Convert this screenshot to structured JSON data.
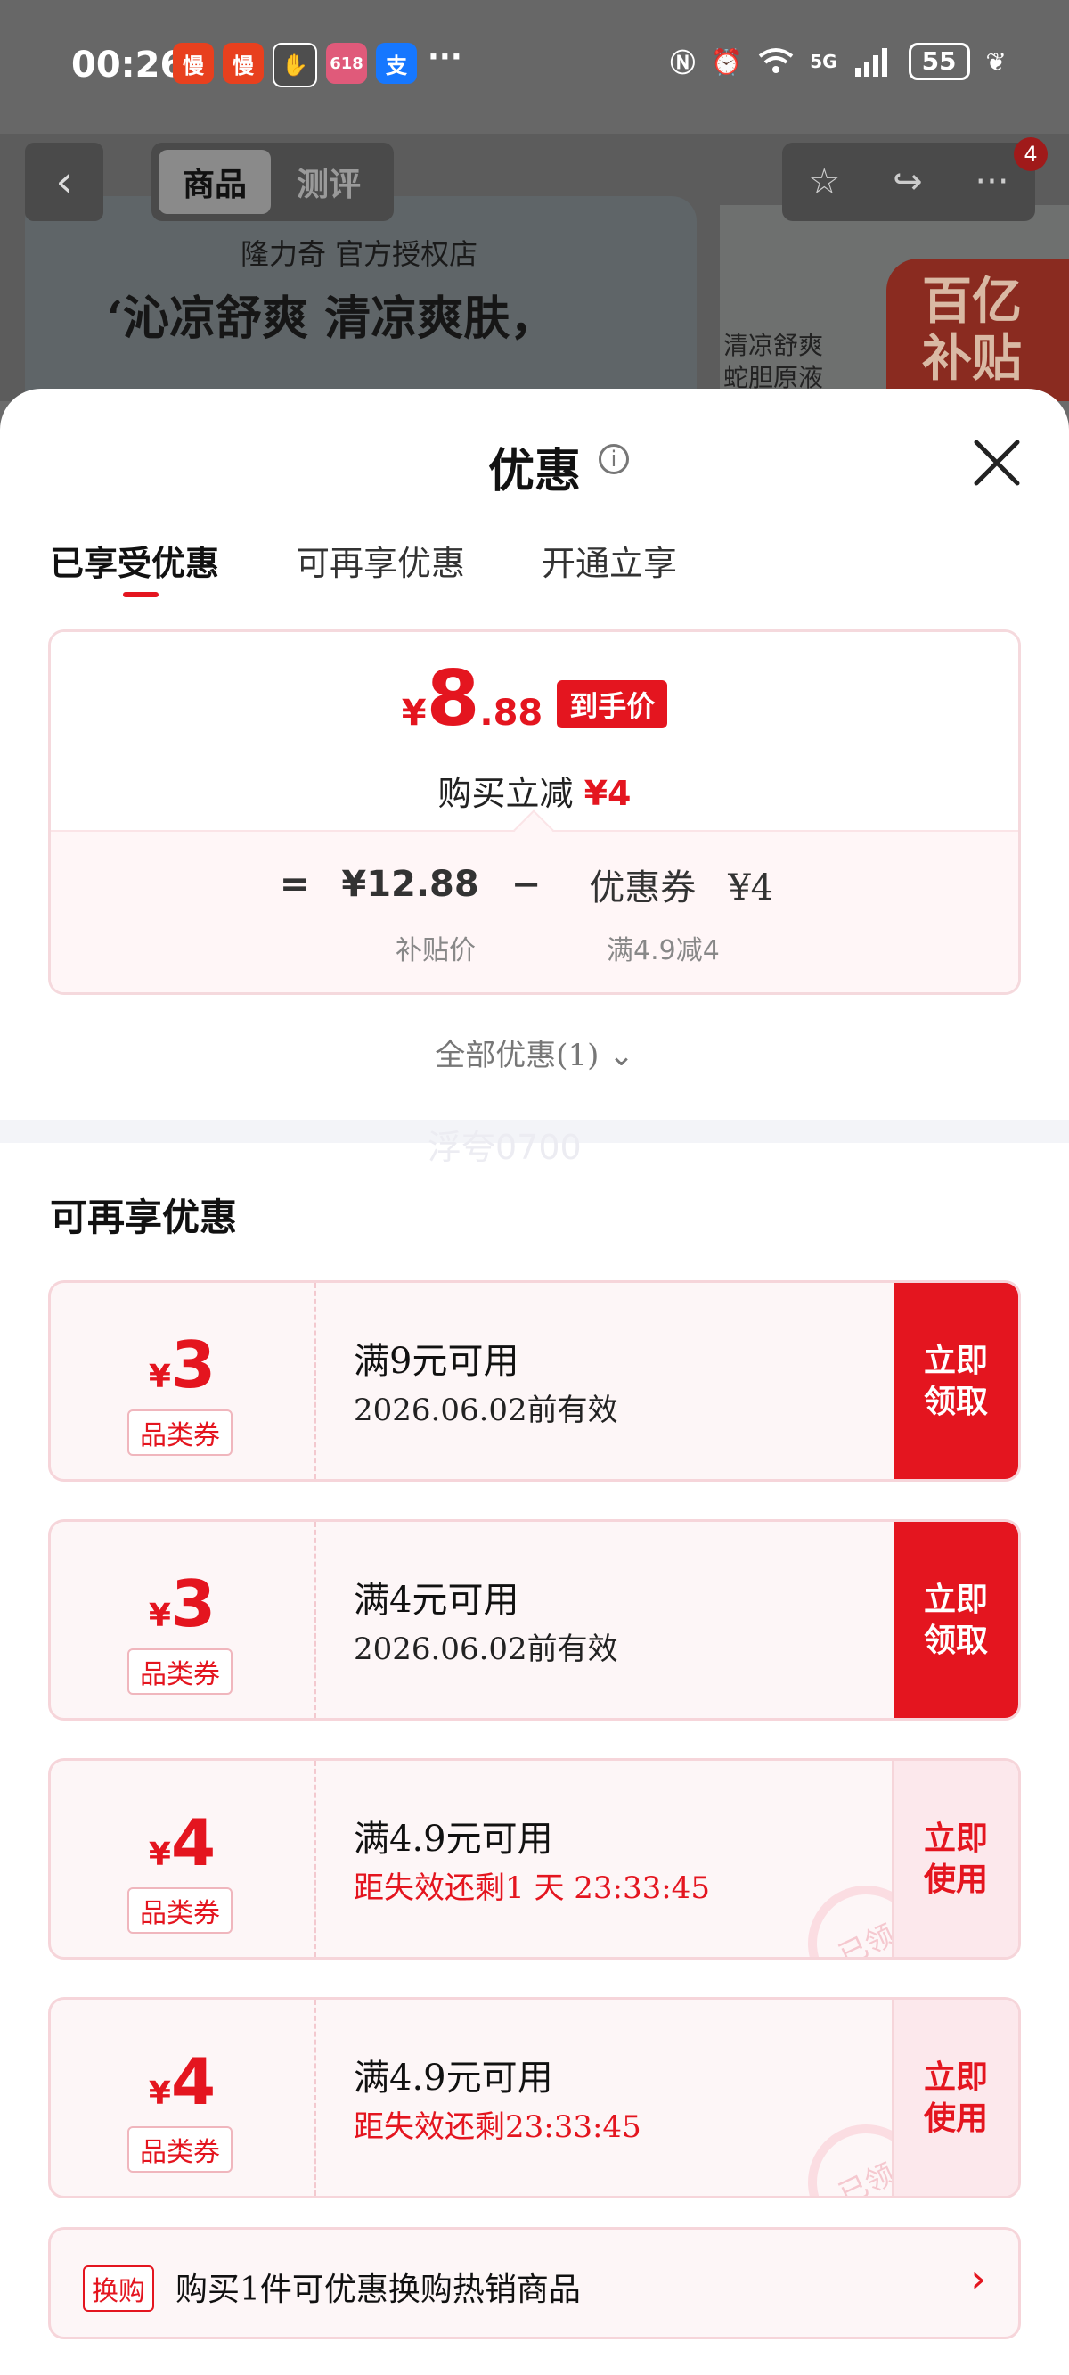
{
  "status_bar": {
    "time": "00:26",
    "app_icons": [
      "慢",
      "慢",
      "✋",
      "618",
      "支"
    ],
    "more": "···",
    "battery": "55",
    "network": "5G"
  },
  "product_header": {
    "back_icon": "‹",
    "tabs": [
      "商品",
      "测评"
    ],
    "store_name": "隆力奇 官方授权店",
    "slogan": "‘沁凉舒爽 清凉爽肤，",
    "banner2_line1": "清凉舒爽",
    "banner2_line2": "蛇胆原液",
    "subsidy_line1": "百亿",
    "subsidy_line2": "补贴",
    "notification_count": "4"
  },
  "sheet": {
    "title": "优惠",
    "tabs": [
      "已享受优惠",
      "可再享优惠",
      "开通立享"
    ],
    "price": {
      "yen": "¥",
      "integer": "8",
      "decimal": ".88",
      "tag": "到手价",
      "reduce_label": "购买立减",
      "reduce_amount": "¥4",
      "eq": "=",
      "base_price": "¥12.88",
      "minus": "−",
      "coupon_label": "优惠券",
      "coupon_amount": "¥4",
      "base_label": "补贴价",
      "coupon_rule": "满4.9减4"
    },
    "all_promos": "全部优惠(1)",
    "watermark": "浮夸0700",
    "section_title": "可再享优惠",
    "coupons": [
      {
        "yen": "¥",
        "amount": "3",
        "type": "品类券",
        "condition": "满9元可用",
        "expiry": "2026.06.02前有效",
        "button": "立即\n领取"
      },
      {
        "yen": "¥",
        "amount": "3",
        "type": "品类券",
        "condition": "满4元可用",
        "expiry": "2026.06.02前有效",
        "button": "立即\n领取"
      },
      {
        "yen": "¥",
        "amount": "4",
        "type": "品类券",
        "condition": "满4.9元可用",
        "expiry": "距失效还剩1 天 23:33:45",
        "button": "立即\n使用",
        "stamp": "已领"
      },
      {
        "yen": "¥",
        "amount": "4",
        "type": "品类券",
        "condition": "满4.9元可用",
        "expiry": "距失效还剩23:33:45",
        "button": "立即\n使用",
        "stamp": "已领"
      }
    ],
    "exchange": {
      "tag": "换购",
      "text": "购买1件可优惠换购热销商品",
      "arrow": "›"
    }
  },
  "colors": {
    "accent": "#e4151f",
    "coupon_bg": "#fdf6f7",
    "border": "#f6d5da"
  }
}
